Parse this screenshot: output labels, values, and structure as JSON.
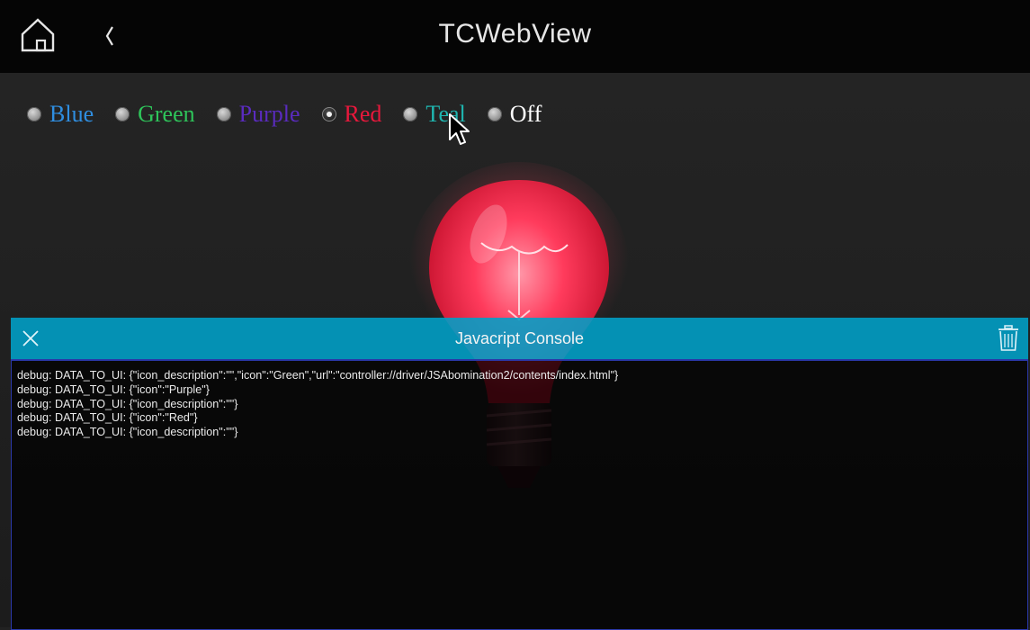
{
  "header": {
    "title": "TCWebView"
  },
  "radios": [
    {
      "label": "Blue",
      "color": "#2f8ee0",
      "selected": false
    },
    {
      "label": "Green",
      "color": "#2ec45a",
      "selected": false
    },
    {
      "label": "Purple",
      "color": "#5a2bbf",
      "selected": false
    },
    {
      "label": "Red",
      "color": "#e8183c",
      "selected": true
    },
    {
      "label": "Teal",
      "color": "#1fb6b0",
      "selected": false
    },
    {
      "label": "Off",
      "color": "#ffffff",
      "selected": false
    }
  ],
  "console": {
    "title": "Javacript Console",
    "header_color": "#00a0c8",
    "lines": [
      "debug: DATA_TO_UI: {\"icon_description\":\"\",\"icon\":\"Green\",\"url\":\"controller://driver/JSAbomination2/contents/index.html\"}",
      "debug: DATA_TO_UI: {\"icon\":\"Purple\"}",
      "debug: DATA_TO_UI: {\"icon_description\":\"\"}",
      "debug: DATA_TO_UI: {\"icon\":\"Red\"}",
      "debug: DATA_TO_UI: {\"icon_description\":\"\"}"
    ]
  },
  "bulb": {
    "color": "#ff3b5c",
    "state": "on"
  }
}
